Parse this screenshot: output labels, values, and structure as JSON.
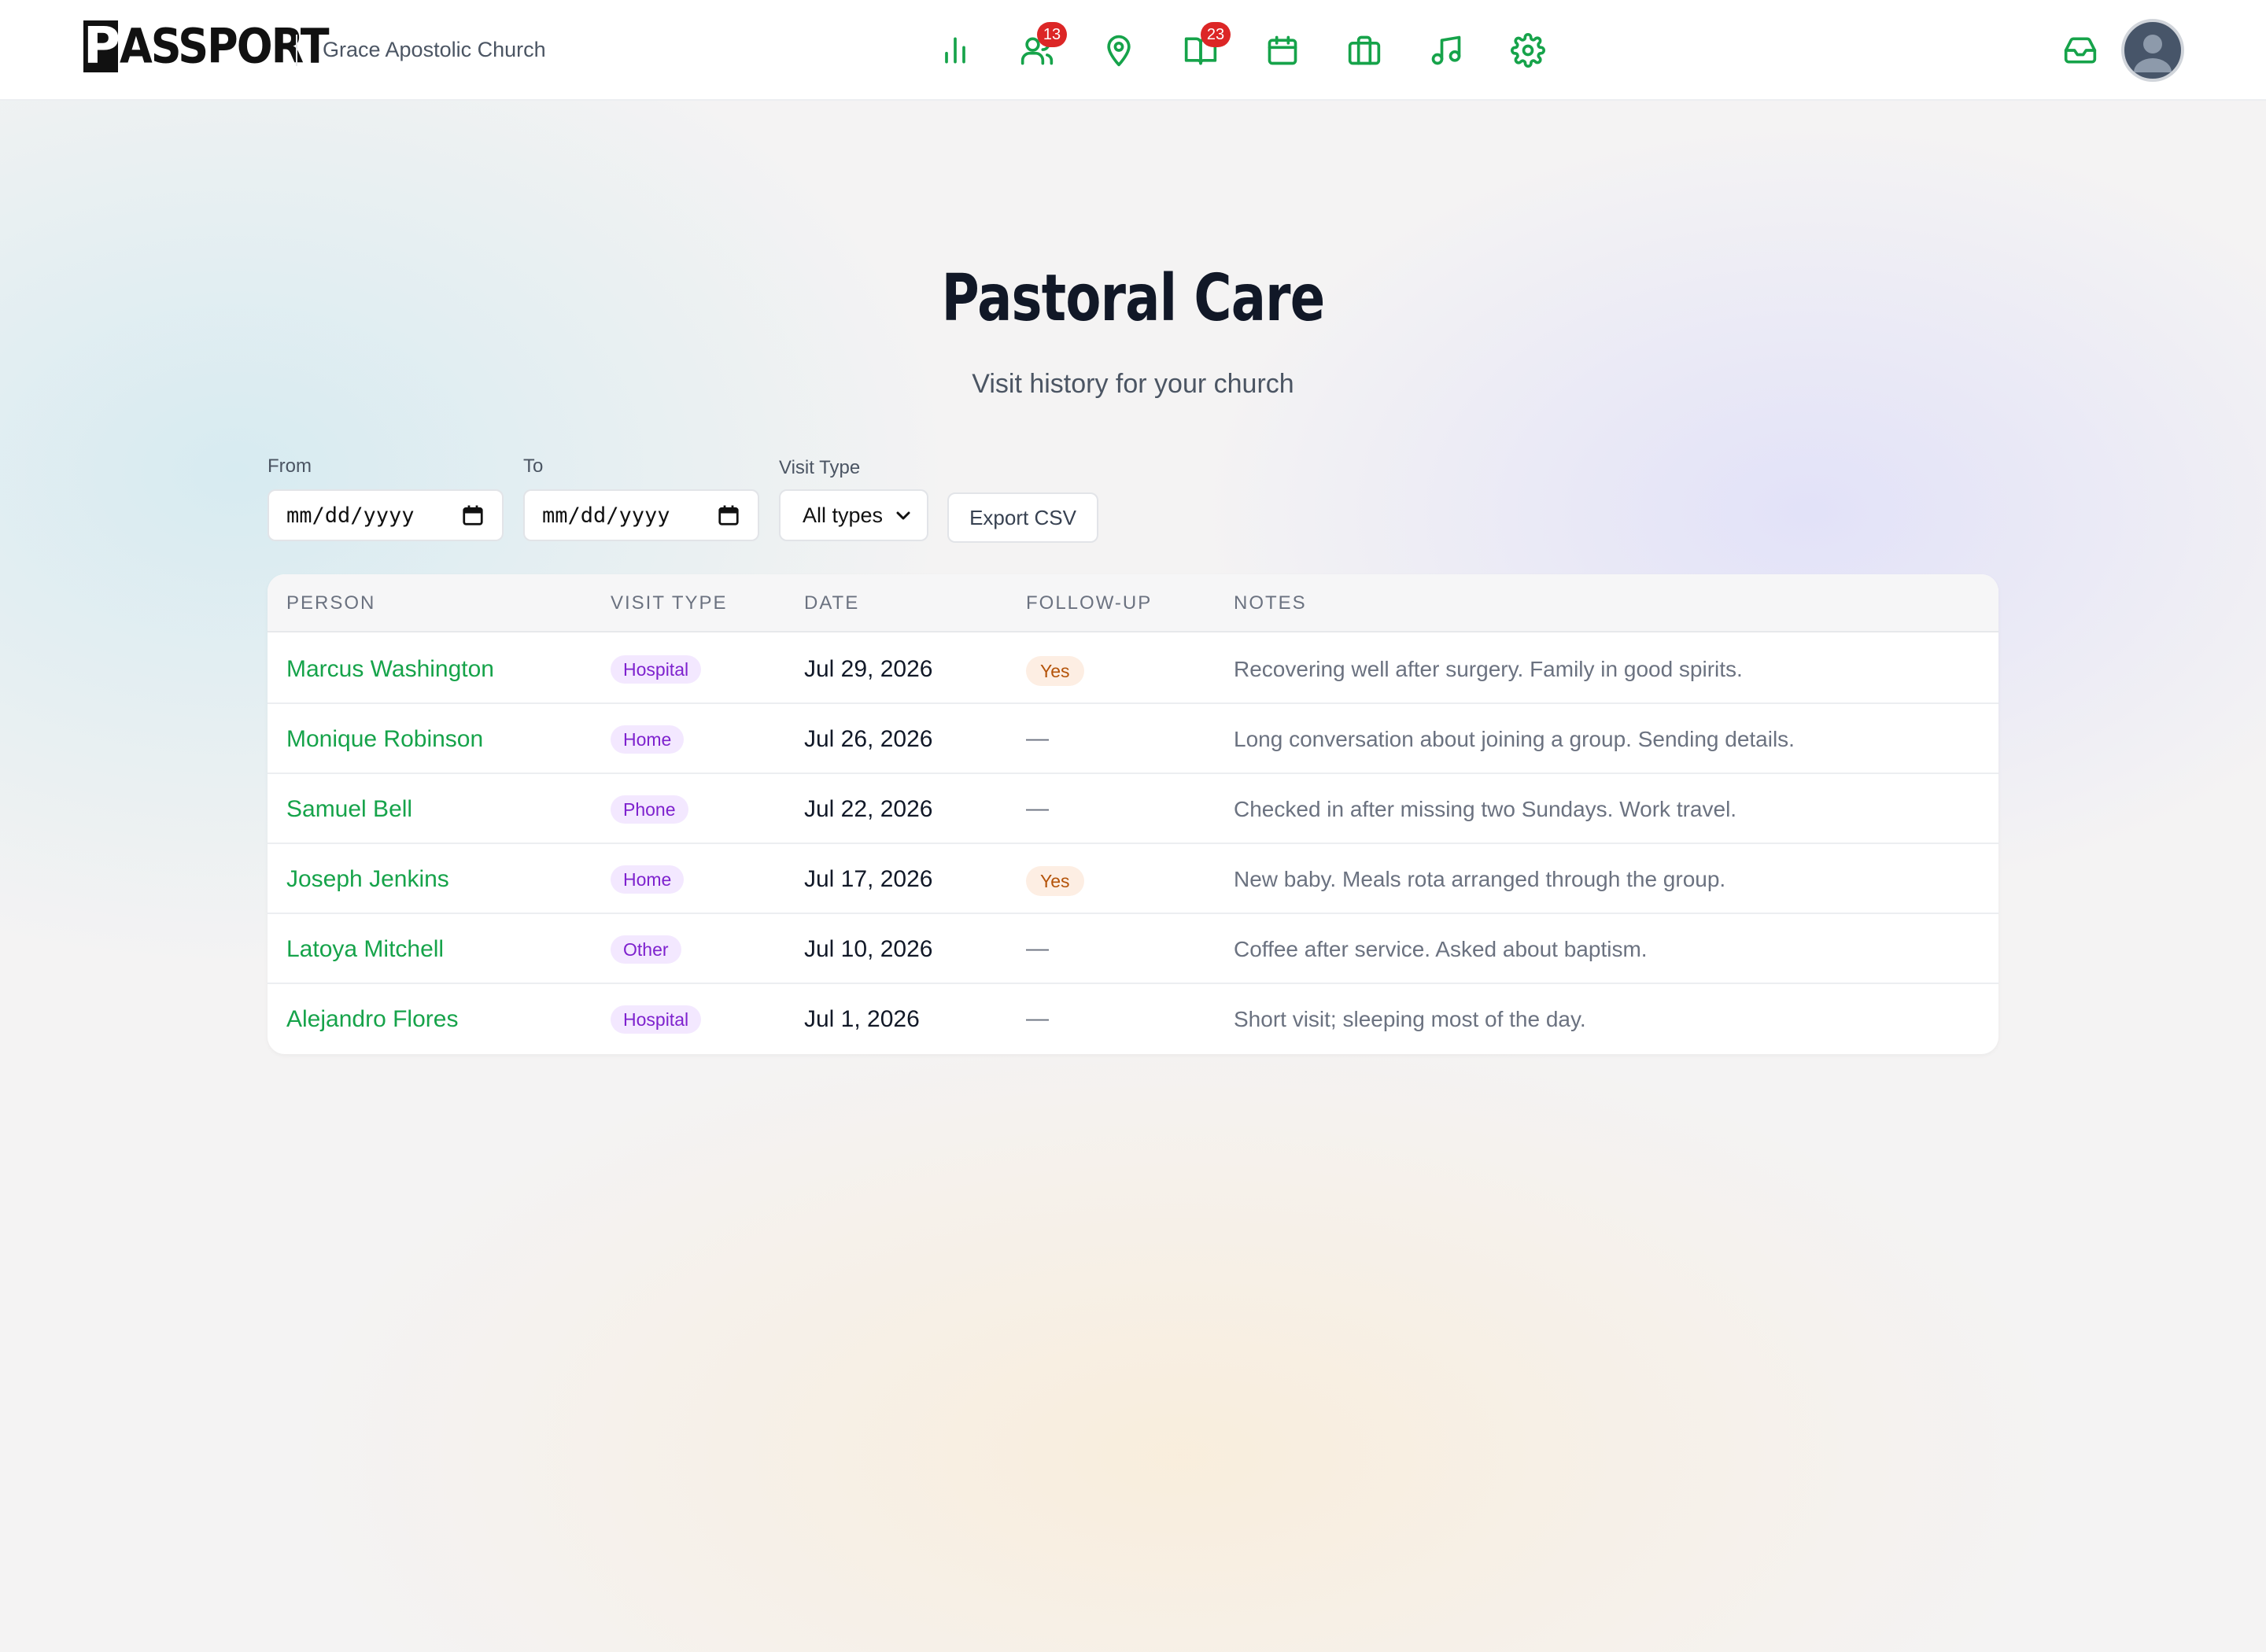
{
  "header": {
    "logo_initial": "P",
    "logo_rest": "ASSPORT",
    "church_name": "Grace Apostolic Church",
    "nav": [
      {
        "icon": "bar-chart-icon"
      },
      {
        "icon": "people-icon",
        "badge": "13"
      },
      {
        "icon": "map-pin-icon"
      },
      {
        "icon": "book-icon",
        "badge": "23"
      },
      {
        "icon": "calendar-icon"
      },
      {
        "icon": "briefcase-icon"
      },
      {
        "icon": "music-icon"
      },
      {
        "icon": "settings-icon"
      }
    ],
    "right_icons": [
      "inbox-icon",
      "avatar"
    ]
  },
  "page": {
    "title": "Pastoral Care",
    "subtitle": "Visit history for your church"
  },
  "filters": {
    "from_label": "From",
    "from_value": "mm/dd/yyyy",
    "to_label": "To",
    "to_value": "mm/dd/yyyy",
    "visit_type_label": "Visit Type",
    "visit_type_value": "All types",
    "export_label": "Export CSV"
  },
  "table": {
    "columns": [
      "PERSON",
      "VISIT TYPE",
      "DATE",
      "FOLLOW-UP",
      "NOTES"
    ],
    "rows": [
      {
        "person": "Marcus Washington",
        "visit_type": "Hospital",
        "date": "Jul 29, 2026",
        "follow_up": "Yes",
        "notes": "Recovering well after surgery. Family in good spirits."
      },
      {
        "person": "Monique Robinson",
        "visit_type": "Home",
        "date": "Jul 26, 2026",
        "follow_up": "—",
        "notes": "Long conversation about joining a group. Sending details."
      },
      {
        "person": "Samuel Bell",
        "visit_type": "Phone",
        "date": "Jul 22, 2026",
        "follow_up": "—",
        "notes": "Checked in after missing two Sundays. Work travel."
      },
      {
        "person": "Joseph Jenkins",
        "visit_type": "Home",
        "date": "Jul 17, 2026",
        "follow_up": "Yes",
        "notes": "New baby. Meals rota arranged through the group."
      },
      {
        "person": "Latoya Mitchell",
        "visit_type": "Other",
        "date": "Jul 10, 2026",
        "follow_up": "—",
        "notes": "Coffee after service. Asked about baptism."
      },
      {
        "person": "Alejandro Flores",
        "visit_type": "Hospital",
        "date": "Jul 1, 2026",
        "follow_up": "—",
        "notes": "Short visit; sleeping most of the day."
      }
    ]
  },
  "colors": {
    "accent": "#16a34a",
    "badge": "#dc2626",
    "visit_type_pill_bg": "#f3e8ff",
    "visit_type_pill_text": "#7e22ce",
    "follow_up_pill_bg": "#fdeee3",
    "follow_up_pill_text": "#b45309"
  }
}
